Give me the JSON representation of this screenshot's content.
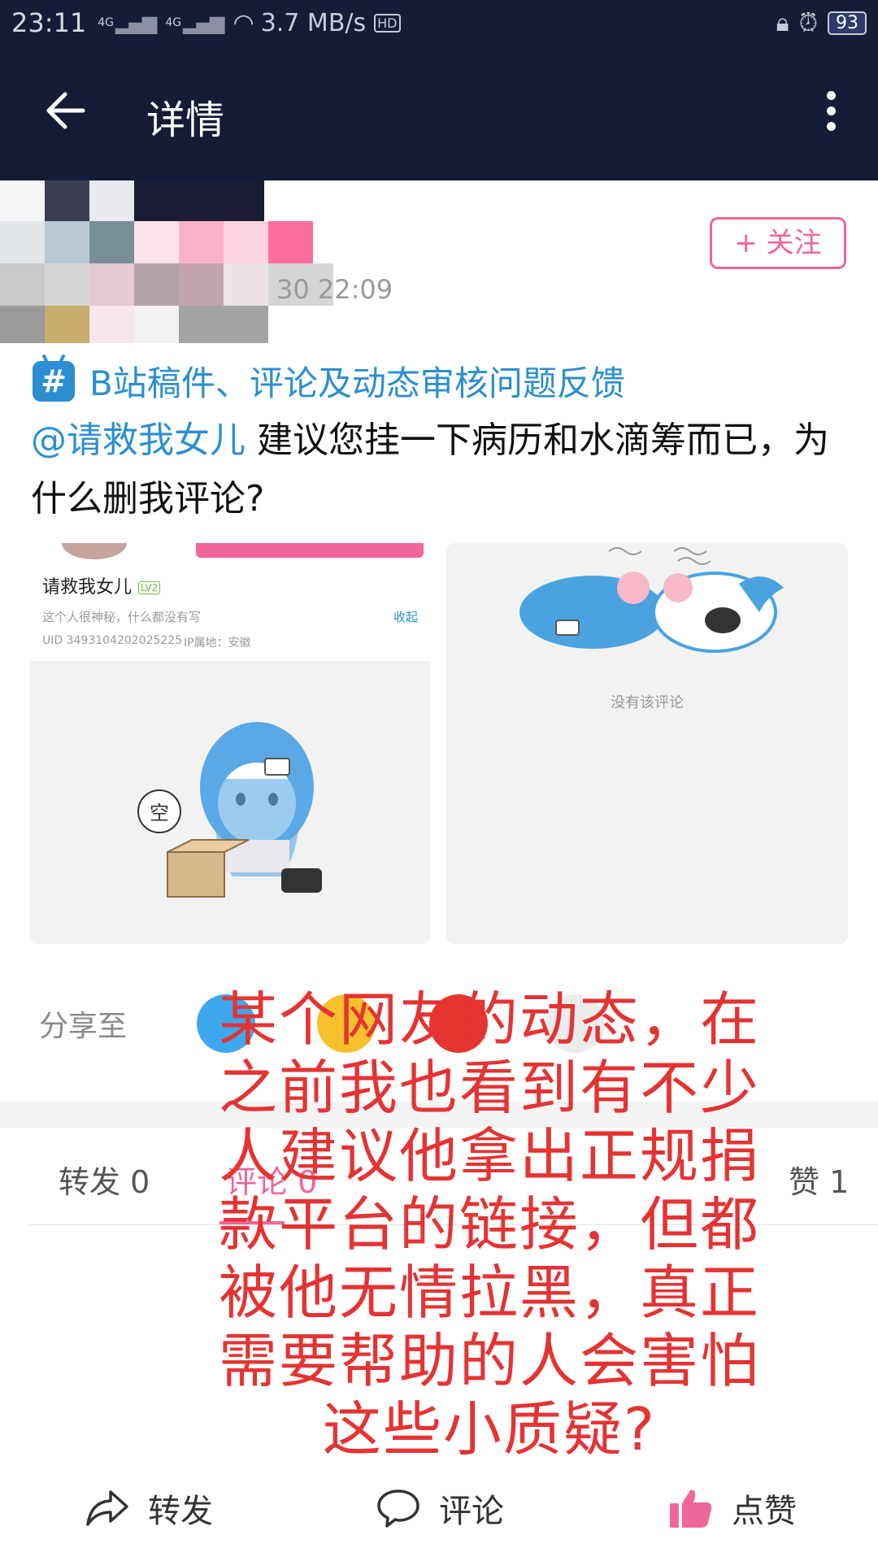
{
  "status_bar": {
    "time": "23:11",
    "network1": "4G",
    "network2": "4G",
    "speed": "3.7 MB/s",
    "hd": "HD",
    "battery": "93"
  },
  "app_bar": {
    "title": "详情"
  },
  "post": {
    "time": "30 22:09",
    "follow_label": "+ 关注",
    "topic": "B站稿件、评论及动态审核问题反馈",
    "mention": "@请救我女儿",
    "text": " 建议您挂一下病历和水滴筹而已，为什么删我评论?"
  },
  "image1": {
    "username": "请救我女儿",
    "level": "LV2",
    "bio": "这个人很神秘，什么都没有写",
    "collapse": "收起",
    "uid": "UID 3493104202025225",
    "ip": "IP属地：安徽",
    "bubble": "空"
  },
  "image2": {
    "empty_text": "没有该评论"
  },
  "share": {
    "label": "分享至"
  },
  "tabs": {
    "repost": "转发 0",
    "comment": "评论 0",
    "like": "赞 1"
  },
  "overlay_text": "某个网友的动态，在之前我也看到有不少人建议他拿出正规捐款平台的链接，但都被他无情拉黑，真正需要帮助的人会害怕这些小质疑?",
  "bottom_bar": {
    "repost": "转发",
    "comment": "评论",
    "like": "点赞"
  },
  "colors": {
    "header_bg": "#161c38",
    "accent_pink": "#f0659a",
    "link_blue": "#2b8fd1",
    "overlay_red": "#e53333"
  }
}
